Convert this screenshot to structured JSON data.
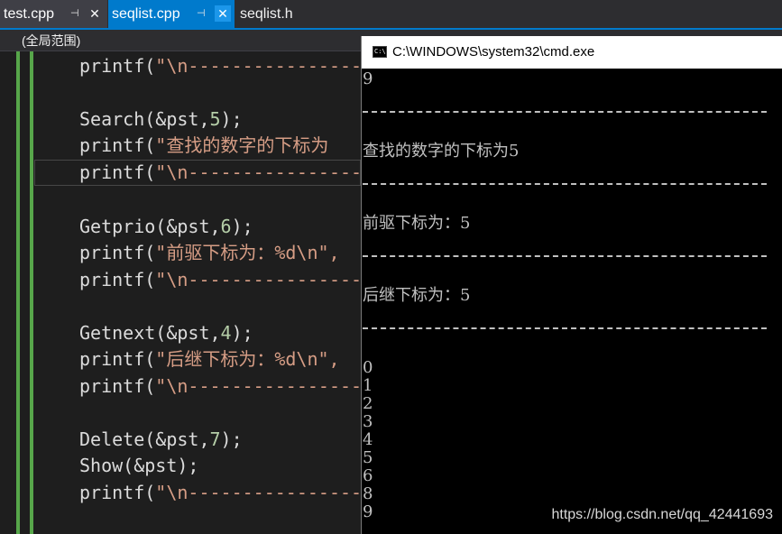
{
  "tabs": [
    {
      "label": "test.cpp",
      "pin": "⊣",
      "close": "✕"
    },
    {
      "label": "seqlist.cpp",
      "pin": "⊣",
      "close": "✕"
    },
    {
      "label": "seqlist.h"
    }
  ],
  "navbar": {
    "scope": "(全局范围)"
  },
  "code": {
    "printf_open": "printf(",
    "dash_str": "\"\\n----------------",
    "search_fn": "Search(&pst,",
    "search_arg": "5",
    "close_semi": ");",
    "search_msg": "\"查找的数字的下标为",
    "getprio_fn": "Getprio(&pst,",
    "getprio_arg": "6",
    "prio_msg": "\"前驱下标为：%d\\n\",",
    "getnext_fn": "Getnext(&pst,",
    "getnext_arg": "4",
    "next_msg": "\"后继下标为：%d\\n\",",
    "delete_fn": "Delete(&pst,",
    "delete_arg": "7",
    "show_fn": "Show(&pst);"
  },
  "cmd": {
    "title": "C:\\WINDOWS\\system32\\cmd.exe",
    "icon_text": "C:\\",
    "first": "9",
    "search_result": "查找的数字的下标为5",
    "prio_result": "前驱下标为：5",
    "next_result": "后继下标为：5",
    "list": [
      "0",
      "1",
      "2",
      "3",
      "4",
      "5",
      "6",
      "8",
      "9"
    ]
  },
  "watermark": "https://blog.csdn.net/qq_42441693"
}
